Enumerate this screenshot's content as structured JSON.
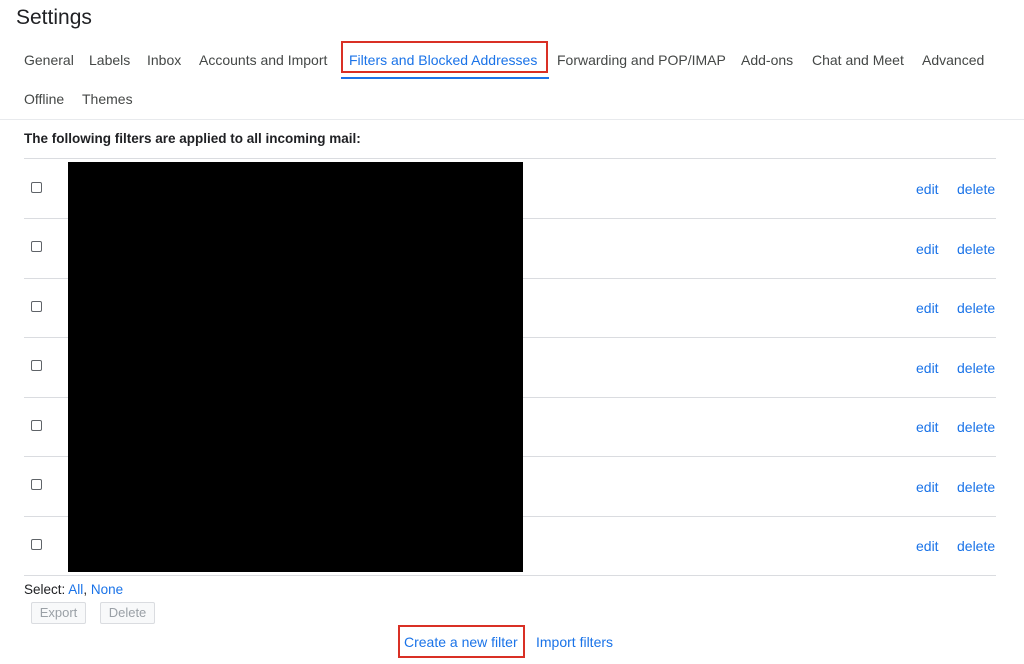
{
  "page": {
    "title": "Settings"
  },
  "tabs": [
    {
      "label": "General"
    },
    {
      "label": "Labels"
    },
    {
      "label": "Inbox"
    },
    {
      "label": "Accounts and Import"
    },
    {
      "label": "Filters and Blocked Addresses",
      "active": true
    },
    {
      "label": "Forwarding and POP/IMAP"
    },
    {
      "label": "Add-ons"
    },
    {
      "label": "Chat and Meet"
    },
    {
      "label": "Advanced"
    },
    {
      "label": "Offline"
    },
    {
      "label": "Themes"
    }
  ],
  "filters": {
    "heading": "The following filters are applied to all incoming mail:",
    "rows": [
      {
        "edit": "edit",
        "delete": "delete"
      },
      {
        "edit": "edit",
        "delete": "delete"
      },
      {
        "edit": "edit",
        "delete": "delete"
      },
      {
        "edit": "edit",
        "delete": "delete"
      },
      {
        "edit": "edit",
        "delete": "delete"
      },
      {
        "edit": "edit",
        "delete": "delete"
      },
      {
        "edit": "edit",
        "delete": "delete"
      }
    ],
    "select_label": "Select:",
    "select_all": "All",
    "select_separator": ",",
    "select_none": "None",
    "export_label": "Export",
    "delete_label": "Delete",
    "create_label": "Create a new filter",
    "import_label": "Import filters"
  },
  "colors": {
    "accent": "#1a73e8",
    "highlight": "#d93025"
  }
}
